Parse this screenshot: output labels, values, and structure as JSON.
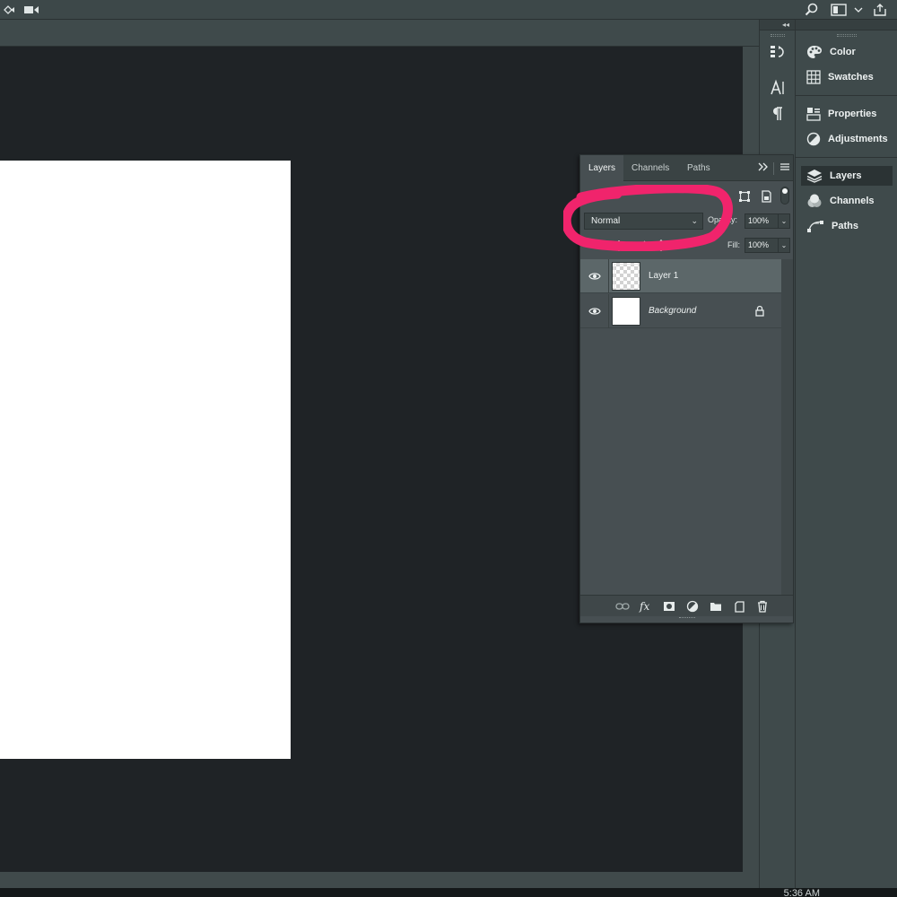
{
  "dock": {
    "items": [
      {
        "label": "Color",
        "icon": "color-palette-icon"
      },
      {
        "label": "Swatches",
        "icon": "swatches-grid-icon"
      },
      {
        "label": "Properties",
        "icon": "properties-icon"
      },
      {
        "label": "Adjustments",
        "icon": "adjustments-icon"
      },
      {
        "label": "Layers",
        "icon": "layers-icon"
      },
      {
        "label": "Channels",
        "icon": "channels-icon"
      },
      {
        "label": "Paths",
        "icon": "paths-icon"
      }
    ]
  },
  "layers_panel": {
    "tabs": [
      {
        "label": "Layers"
      },
      {
        "label": "Channels"
      },
      {
        "label": "Paths"
      }
    ],
    "blend_mode": "Normal",
    "opacity_label": "Opacity:",
    "opacity_value": "100%",
    "fill_label": "Fill:",
    "fill_value": "100%",
    "layers": [
      {
        "name": "Layer 1",
        "visible": true,
        "selected": true
      },
      {
        "name": "Background",
        "visible": true,
        "locked": true
      }
    ]
  },
  "taskbar": {
    "clock": "5:36 AM"
  },
  "colors": {
    "annotation": "#f0246c",
    "panel_bg": "#474f52",
    "canvas_bg": "#1f2326"
  }
}
